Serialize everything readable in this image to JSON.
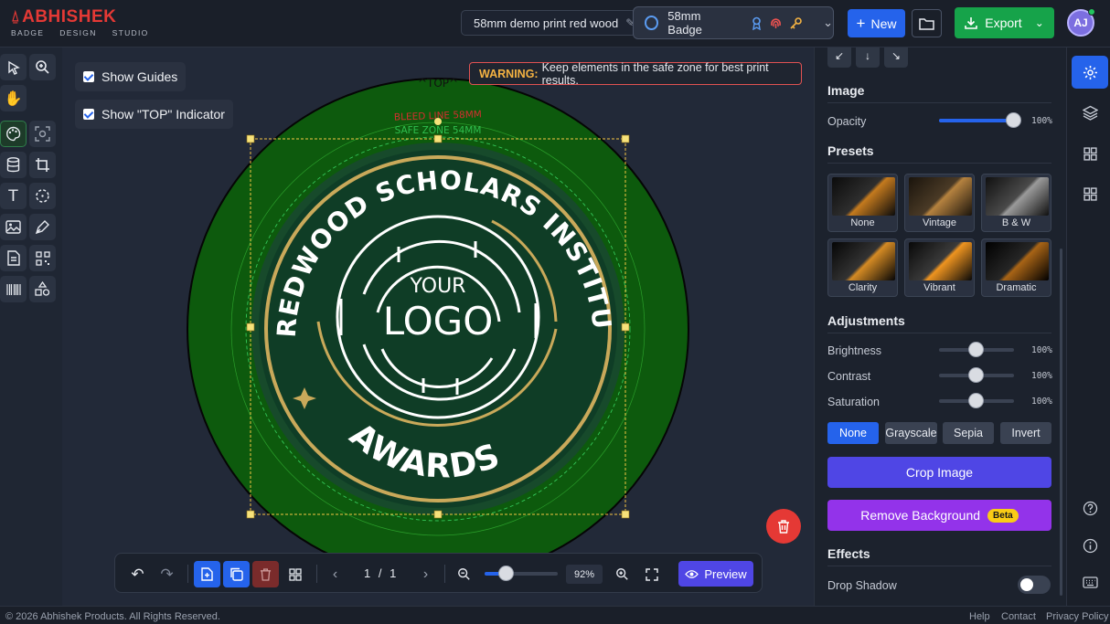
{
  "brand": {
    "name": "ABHISHEK",
    "tagline": [
      "BADGE",
      "DESIGN",
      "STUDIO"
    ],
    "color": "#e53935"
  },
  "header": {
    "doc_name": "58mm demo print red wood",
    "badge_type": "58mm Badge",
    "new_label": "New",
    "export_label": "Export",
    "avatar_initials": "AJ",
    "icons": [
      "pencil-icon",
      "circle-badge-icon",
      "award-ribbon-icon",
      "fingerprint-icon",
      "key-icon",
      "chevron-down-icon",
      "plus-icon",
      "folder-icon",
      "download-icon"
    ]
  },
  "canvas": {
    "show_guides_label": "Show Guides",
    "show_top_label": "Show \"TOP\" Indicator",
    "warning_title": "WARNING:",
    "warning_text": "Keep elements in the safe zone for best print results.",
    "top_marker": "^TOP^",
    "bleed_label": "BLEED LINE 58MM",
    "safe_label": "SAFE ZONE 54MM",
    "badge": {
      "arc_text": "REDWOOD SCHOLARS INSTITUTE",
      "your": "YOUR",
      "logo": "LOGO",
      "awards": "AWARDS",
      "bg": "#0d5a0d",
      "inner": "#0f3d26",
      "gold": "#c9a95a"
    }
  },
  "bottom_bar": {
    "page_current": "1",
    "page_sep": "/",
    "page_total": "1",
    "zoom": "92%",
    "zoom_level": 0.3,
    "preview_label": "Preview"
  },
  "panel": {
    "image_title": "Image",
    "opacity_label": "Opacity",
    "opacity_value": "100%",
    "opacity_level": 1.0,
    "presets_title": "Presets",
    "presets": [
      "None",
      "Vintage",
      "B & W",
      "Clarity",
      "Vibrant",
      "Dramatic"
    ],
    "adjustments_title": "Adjustments",
    "brightness_label": "Brightness",
    "brightness_value": "100%",
    "contrast_label": "Contrast",
    "contrast_value": "100%",
    "saturation_label": "Saturation",
    "saturation_value": "100%",
    "filters": [
      "None",
      "Grayscale",
      "Sepia",
      "Invert"
    ],
    "active_filter": "None",
    "crop_label": "Crop Image",
    "remove_bg_label": "Remove Background",
    "beta_label": "Beta",
    "effects_title": "Effects",
    "drop_shadow_label": "Drop Shadow",
    "drop_shadow_on": false
  },
  "footer": {
    "copyright": "© 2026 Abhishek Products. All Rights Reserved.",
    "help": "Help",
    "contact": "Contact",
    "privacy": "Privacy Policy"
  },
  "colors": {
    "accent": "#2563eb",
    "export": "#16a34a",
    "crop": "#4f46e5",
    "remove_bg": "#9333ea",
    "danger": "#e53935"
  }
}
